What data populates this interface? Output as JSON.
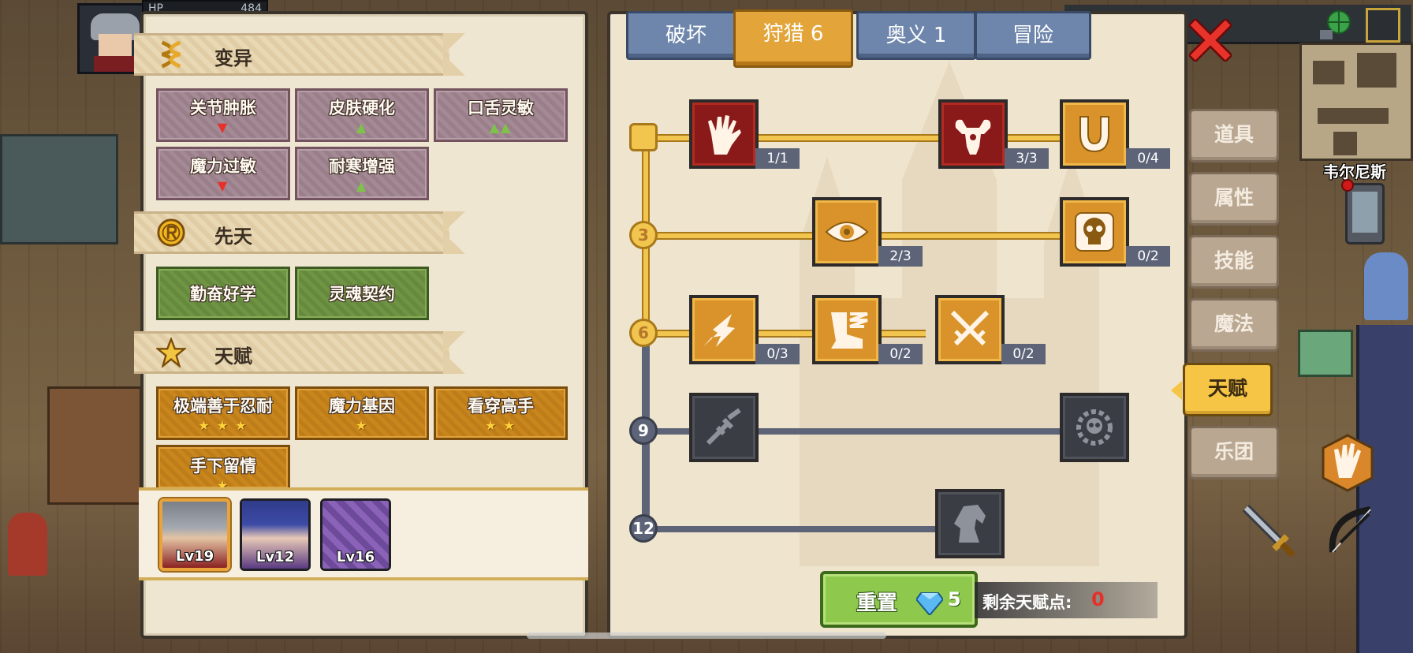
{
  "hud": {
    "hp_label": "HP",
    "hp_value": "484",
    "npc_name": "韦尔尼斯"
  },
  "left_panel": {
    "sections": [
      {
        "title": "变异",
        "icon": "dna-icon"
      },
      {
        "title": "先天",
        "icon": "r-coin-icon"
      },
      {
        "title": "天赋",
        "icon": "star-icon"
      }
    ],
    "mutations": [
      {
        "label": "关节肿胀",
        "marks": "▼",
        "trend": "down"
      },
      {
        "label": "皮肤硬化",
        "marks": "▲",
        "trend": "up"
      },
      {
        "label": "口舌灵敏",
        "marks": "▲▲",
        "trend": "up"
      },
      {
        "label": "魔力过敏",
        "marks": "▼",
        "trend": "down"
      },
      {
        "label": "耐寒增强",
        "marks": "▲",
        "trend": "up"
      }
    ],
    "innate": [
      {
        "label": "勤奋好学"
      },
      {
        "label": "灵魂契约"
      }
    ],
    "talents": [
      {
        "label": "极端善于忍耐",
        "stars": "★ ★ ★"
      },
      {
        "label": "魔力基因",
        "stars": "★"
      },
      {
        "label": "看穿高手",
        "stars": "★ ★"
      },
      {
        "label": "手下留情",
        "stars": "★"
      }
    ],
    "party": [
      {
        "level": "Lv19",
        "selected": true
      },
      {
        "level": "Lv12",
        "selected": false
      },
      {
        "level": "Lv16",
        "selected": false
      }
    ]
  },
  "right_panel": {
    "tabs": [
      {
        "label": "破坏",
        "active": false
      },
      {
        "label": "狩猎 6",
        "active": true
      },
      {
        "label": "奥义 1",
        "active": false
      },
      {
        "label": "冒险",
        "active": false
      }
    ],
    "tiers": [
      "3",
      "6",
      "9",
      "12"
    ],
    "skills": {
      "hand": {
        "count": "1/1",
        "icon": "hand-icon"
      },
      "strength": {
        "count": "3/3",
        "icon": "flexing-arm-icon"
      },
      "horseshoe": {
        "count": "0/4",
        "icon": "horseshoe-icon"
      },
      "eye": {
        "count": "2/3",
        "icon": "eye-icon"
      },
      "skull_shield": {
        "count": "0/2",
        "icon": "skull-shield-icon"
      },
      "lightning": {
        "count": "0/3",
        "icon": "lightning-icon"
      },
      "boot": {
        "count": "0/2",
        "icon": "winged-boot-icon"
      },
      "crossed_swords": {
        "count": "0/2",
        "icon": "crossed-swords-icon"
      },
      "syringe": {
        "icon": "syringe-icon"
      },
      "skull_gear": {
        "icon": "skull-gear-icon"
      },
      "horse": {
        "icon": "horse-head-icon"
      }
    },
    "reset": {
      "label": "重置",
      "cost": "5"
    },
    "points": {
      "label": "剩余天赋点:",
      "value": "0"
    }
  },
  "side_menu": [
    {
      "label": "道具",
      "active": false
    },
    {
      "label": "属性",
      "active": false
    },
    {
      "label": "技能",
      "active": false
    },
    {
      "label": "魔法",
      "active": false
    },
    {
      "label": "天赋",
      "active": true
    },
    {
      "label": "乐团",
      "active": false
    }
  ],
  "colors": {
    "gold": "#d9932a",
    "active_path": "#f2c54e",
    "locked_path": "#5d6478",
    "mutation_bg": "#a48a94",
    "innate_bg": "#6f9444",
    "talent_bg": "#c9861d",
    "reset_green": "#8ec94e",
    "points_red": "#e5302a"
  }
}
